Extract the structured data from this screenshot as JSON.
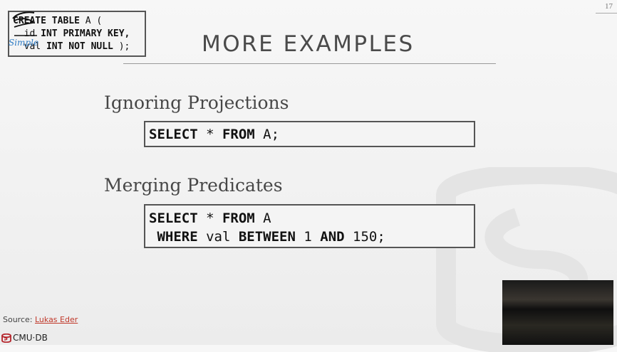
{
  "slide": {
    "number": "17",
    "title": "MORE EXAMPLES"
  },
  "corner_code": {
    "line1_kw": "CREATE TABLE",
    "line1_rest": " A (",
    "line2_ident": "id",
    "line2_kw": " INT PRIMARY KEY,",
    "line3_ident": "val",
    "line3_kw": " INT NOT NULL",
    "line3_rest": " );",
    "annotation": "Simple"
  },
  "sections": [
    {
      "heading": "Ignoring Projections",
      "code": {
        "l1_kw1": "SELECT",
        "l1_op": " * ",
        "l1_kw2": "FROM",
        "l1_rest": " A;"
      }
    },
    {
      "heading": "Merging Predicates",
      "code": {
        "l1_kw1": "SELECT",
        "l1_op": " * ",
        "l1_kw2": "FROM",
        "l1_rest": " A",
        "l2_kw1": "WHERE",
        "l2_a": " val ",
        "l2_kw2": "BETWEEN",
        "l2_b": " 1 ",
        "l2_kw3": "AND",
        "l2_c": " 150;"
      }
    }
  ],
  "footer": {
    "source_label": "Source: ",
    "source_link": "Lukas Eder",
    "logo_text": "CMU·DB",
    "link_color": "#c0392b",
    "logo_color": "#b5242b"
  }
}
